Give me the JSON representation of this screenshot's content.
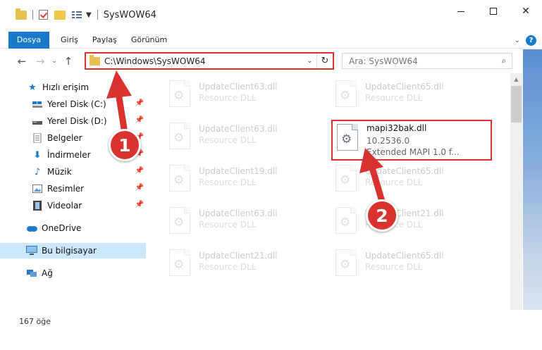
{
  "window": {
    "title": "SysWOW64",
    "controls": {
      "minimize": "minimize",
      "maximize": "maximize",
      "close": "✕"
    }
  },
  "ribbon": {
    "tabs": [
      "Dosya",
      "Giriş",
      "Paylaş",
      "Görünüm"
    ]
  },
  "nav": {
    "address": "C:\\Windows\\SysWOW64",
    "search_placeholder": "Ara: SysWOW64"
  },
  "sidebar": {
    "quick_access": "Hızlı erişim",
    "items": [
      {
        "label": "Yerel Disk (C:)",
        "icon": "drive-c-icon",
        "pinned": true
      },
      {
        "label": "Yerel Disk (D:)",
        "icon": "drive-d-icon",
        "pinned": true
      },
      {
        "label": "Belgeler",
        "icon": "documents-icon",
        "pinned": true
      },
      {
        "label": "İndirmeler",
        "icon": "download-icon",
        "pinned": true
      },
      {
        "label": "Müzik",
        "icon": "music-icon",
        "pinned": true
      },
      {
        "label": "Resimler",
        "icon": "pictures-icon",
        "pinned": true
      },
      {
        "label": "Videolar",
        "icon": "videos-icon",
        "pinned": true
      }
    ],
    "onedrive": "OneDrive",
    "this_pc": "Bu bilgisayar",
    "network": "Ağ"
  },
  "files": {
    "left": [
      {
        "name": "UpdateClient63.dll",
        "sub": "Resource DLL"
      },
      {
        "name": "UpdateClient63.dll",
        "sub": "Resource DLL"
      },
      {
        "name": "UpdateClient19.dll",
        "sub": "Resource DLL"
      },
      {
        "name": "UpdateClient63.dll",
        "sub": "Resource DLL"
      },
      {
        "name": "UpdateClient21.dll",
        "sub": "Resource DLL"
      }
    ],
    "right": [
      {
        "name": "UpdateClient65.dll",
        "sub": "Resource DLL"
      },
      {
        "name": "UpdateClient65.dll",
        "sub": "Resource DLL"
      },
      {
        "name": "UpdateClient21.dll",
        "sub": "Resource DLL"
      },
      {
        "name": "UpdateClient65.dll",
        "sub": "Resource DLL"
      }
    ],
    "highlighted": {
      "name": "mapi32bak.dll",
      "version": "10.2536.0",
      "description": "Extended MAPI 1.0 f..."
    }
  },
  "status": {
    "item_count": "167 öğe"
  },
  "annotations": {
    "step1": "1",
    "step2": "2",
    "color": "#d9322f"
  }
}
